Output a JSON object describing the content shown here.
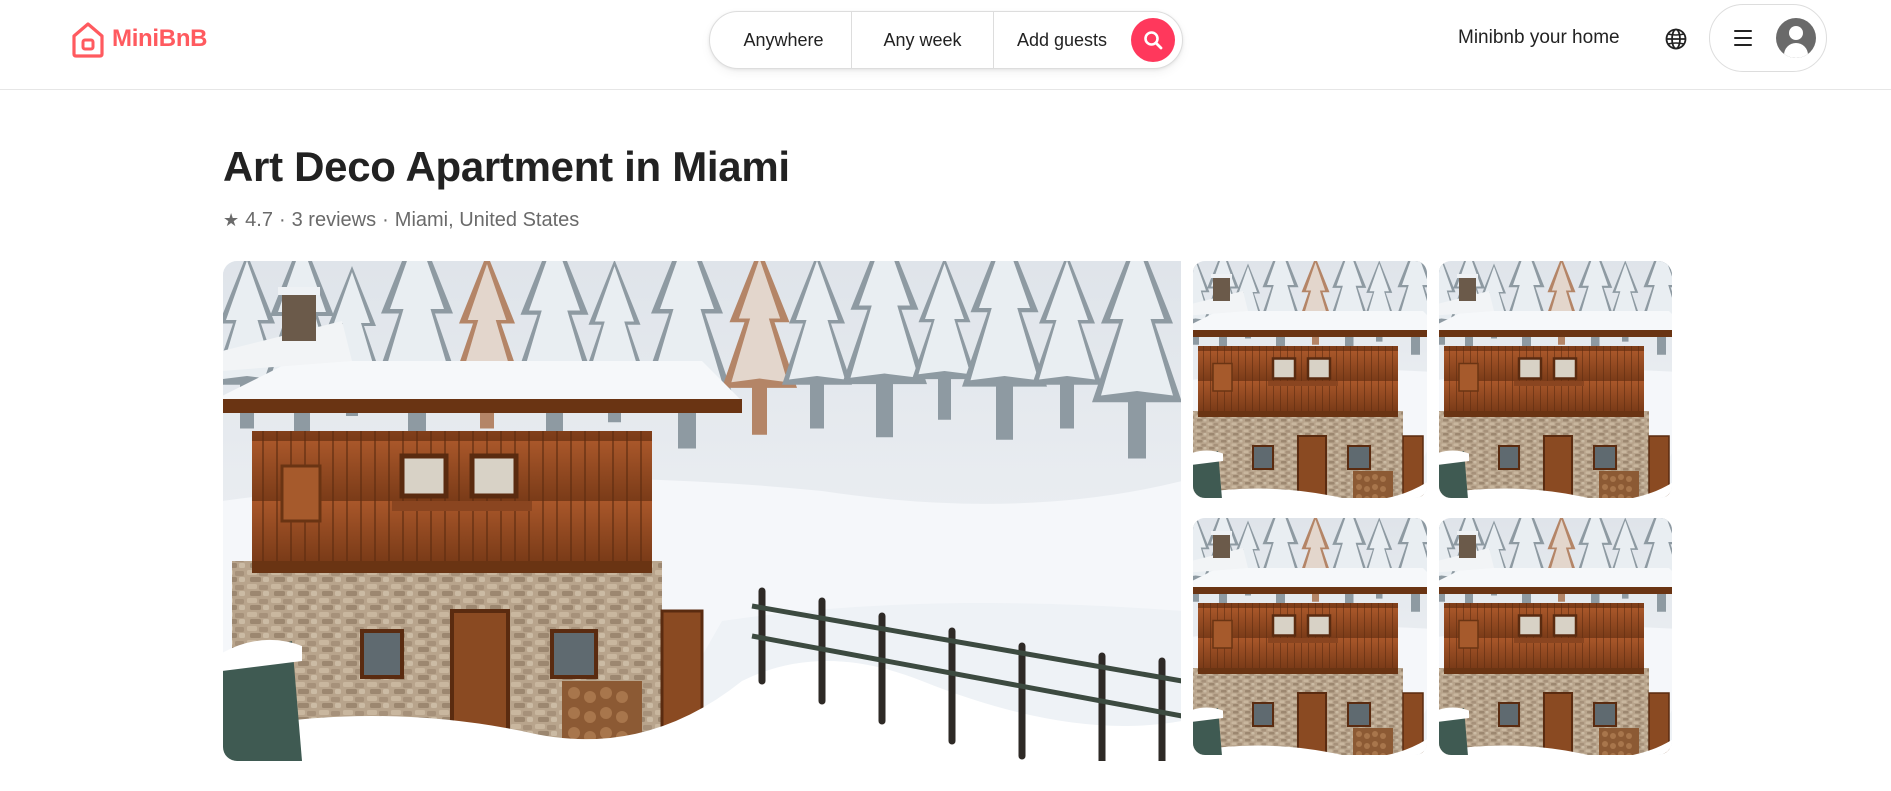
{
  "brand": {
    "name": "MiniBnB",
    "color": "#ff5a5f",
    "icon": "house-icon"
  },
  "search": {
    "where_label": "Anywhere",
    "when_label": "Any week",
    "guests_label": "Add guests",
    "button_icon": "search-icon",
    "button_color": "#ff385c"
  },
  "header": {
    "host_link": "Minibnb your home",
    "globe_icon": "globe-icon",
    "menu_icon": "hamburger-icon",
    "avatar_icon": "user-avatar-icon"
  },
  "listing": {
    "title": "Art Deco Apartment in Miami",
    "rating": "4.7",
    "reviews": "3 reviews",
    "location": "Miami, United States",
    "separator": "·",
    "star_icon": "★"
  }
}
